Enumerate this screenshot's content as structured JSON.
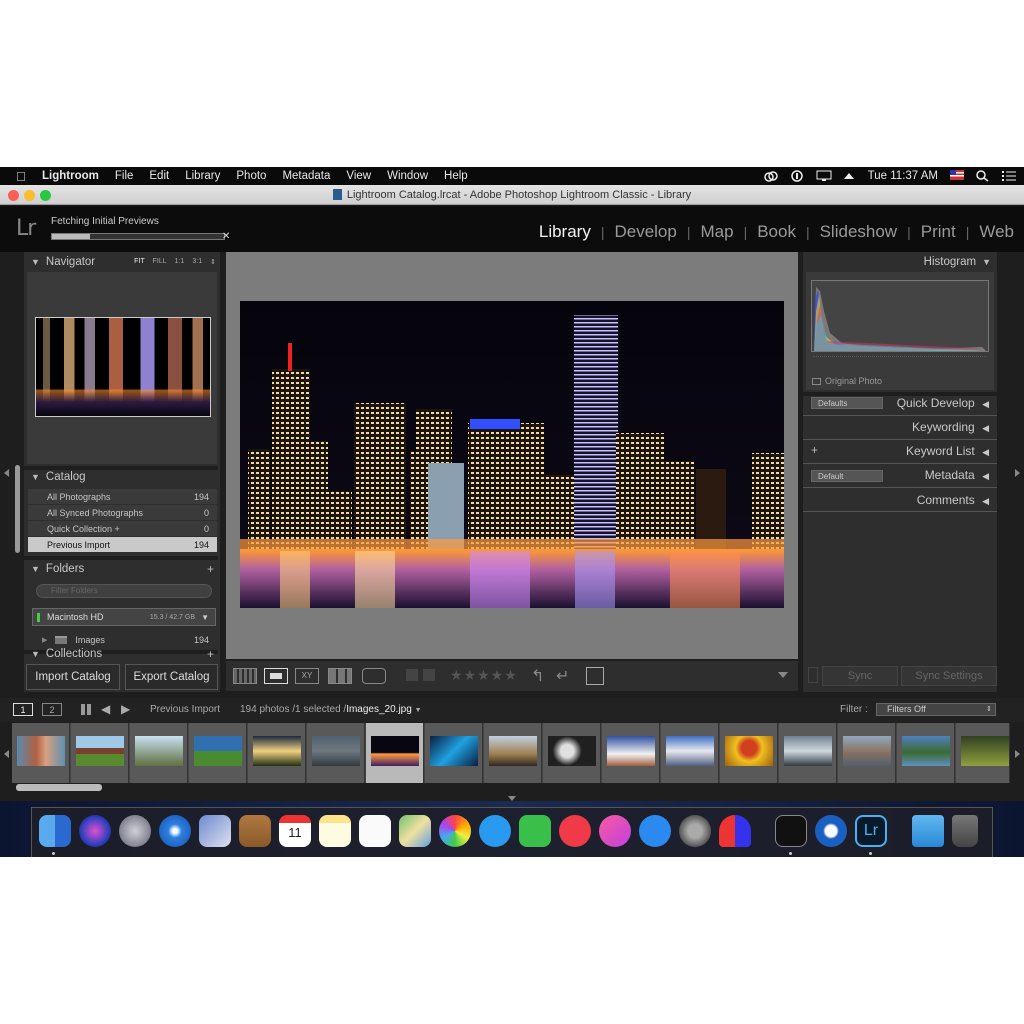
{
  "menubar": {
    "apple_icon": "apple-logo-icon",
    "items": [
      "Lightroom",
      "File",
      "Edit",
      "Library",
      "Photo",
      "Metadata",
      "View",
      "Window",
      "Help"
    ],
    "clock": "Tue 11:37 AM"
  },
  "window": {
    "title": "Lightroom Catalog.lrcat - Adobe Photoshop Lightroom Classic - Library"
  },
  "identity": {
    "logo": "Lr",
    "status": "Fetching Initial Previews",
    "progress": 0.22,
    "close": "✕"
  },
  "modules": [
    "Library",
    "Develop",
    "Map",
    "Book",
    "Slideshow",
    "Print",
    "Web"
  ],
  "navigator": {
    "title": "Navigator",
    "zoom": [
      "FIT",
      "FILL",
      "1:1",
      "3:1"
    ]
  },
  "catalog": {
    "title": "Catalog",
    "items": [
      {
        "label": "All Photographs",
        "count": "194"
      },
      {
        "label": "All Synced Photographs",
        "count": "0"
      },
      {
        "label": "Quick Collection  +",
        "count": "0"
      },
      {
        "label": "Previous Import",
        "count": "194"
      }
    ]
  },
  "folders": {
    "title": "Folders",
    "filter_placeholder": "Filter Folders",
    "volume": "Macintosh HD",
    "volume_size": "15.3 / 42.7 GB",
    "folder": "Images",
    "folder_count": "194"
  },
  "collections": {
    "title": "Collections"
  },
  "left_buttons": {
    "import": "Import Catalog",
    "export": "Export Catalog"
  },
  "right": {
    "histogram": "Histogram",
    "original_photo": "Original Photo",
    "quick_develop": "Quick Develop",
    "defaults": "Defaults",
    "keywording": "Keywording",
    "keyword_list": "Keyword List",
    "metadata": "Metadata",
    "metadata_default": "Default",
    "comments": "Comments",
    "sync": "Sync",
    "sync_settings": "Sync Settings"
  },
  "filmstrip_bar": {
    "page1": "1",
    "page2": "2",
    "source": "Previous Import",
    "info": "194 photos /1 selected /",
    "file": "Images_20.jpg",
    "filter_label": "Filter :",
    "filter_value": "Filters Off"
  },
  "colors": {
    "accent": "#f2f2f2",
    "panel": "#2e2e2e",
    "selected_row": "#c9c9c9"
  }
}
